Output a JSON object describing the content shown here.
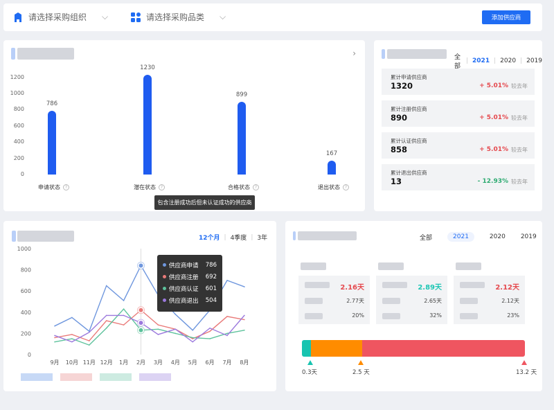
{
  "toolbar": {
    "org_placeholder": "请选择采购组织",
    "cat_placeholder": "请选择采购品类",
    "add_label": "添加供应商"
  },
  "status_chart": {
    "chart_data": {
      "type": "bar",
      "categories": [
        "申请状态",
        "潜在状态",
        "合格状态",
        "退出状态"
      ],
      "values": [
        786,
        1230,
        899,
        167
      ],
      "yticks": [
        1200,
        1000,
        800,
        600,
        400,
        200,
        0
      ],
      "ylim": [
        0,
        1230
      ],
      "grid": false
    },
    "tooltip": "包含注册成功后但未认证成功的供应商"
  },
  "supplier_stats": {
    "tabs": [
      "全部",
      "2021",
      "2020",
      "2019"
    ],
    "active_tab": "2021",
    "items": [
      {
        "label": "累计申请供应商",
        "value": "1320",
        "delta": "+ 5.01%",
        "suffix": "较去年",
        "dir": "up"
      },
      {
        "label": "累计注册供应商",
        "value": "890",
        "delta": "+ 5.01%",
        "suffix": "较去年",
        "dir": "up"
      },
      {
        "label": "累计认证供应商",
        "value": "858",
        "delta": "+ 5.01%",
        "suffix": "较去年",
        "dir": "up"
      },
      {
        "label": "累计退出供应商",
        "value": "13",
        "delta": "- 12.93%",
        "suffix": "较去年",
        "dir": "down"
      }
    ]
  },
  "trend_chart": {
    "tabs": [
      "12个月",
      "4季度",
      "3年"
    ],
    "active_tab": "12个月",
    "chart_data": {
      "type": "line",
      "categories": [
        "9月",
        "10月",
        "11月",
        "12月",
        "1月",
        "2月",
        "3月",
        "4月",
        "5月",
        "6月",
        "7月",
        "8月"
      ],
      "ylim": [
        0,
        1000
      ],
      "yticks": [
        1000,
        800,
        600,
        400,
        200,
        0
      ],
      "series": [
        {
          "name": "供应商申请",
          "color": "#6f97de",
          "values": [
            270,
            350,
            220,
            650,
            510,
            840,
            560,
            380,
            230,
            420,
            700,
            640
          ]
        },
        {
          "name": "供应商注册",
          "color": "#e97a79",
          "values": [
            160,
            190,
            130,
            320,
            280,
            420,
            280,
            240,
            150,
            220,
            360,
            330
          ]
        },
        {
          "name": "供应商认证",
          "color": "#5dc29c",
          "values": [
            120,
            150,
            90,
            250,
            430,
            230,
            240,
            200,
            160,
            150,
            200,
            230
          ]
        },
        {
          "name": "供应商退出",
          "color": "#9b78dd",
          "values": [
            180,
            120,
            210,
            370,
            370,
            300,
            190,
            240,
            120,
            250,
            180,
            370
          ]
        }
      ]
    },
    "tooltip": {
      "month_index": 5,
      "rows": [
        {
          "name": "供应商申请",
          "value": "786"
        },
        {
          "name": "供应商注册",
          "value": "692"
        },
        {
          "name": "供应商认证",
          "value": "601"
        },
        {
          "name": "供应商退出",
          "value": "504"
        }
      ]
    }
  },
  "cycle": {
    "tabs": [
      "全部",
      "2021",
      "2020",
      "2019"
    ],
    "active_tab": "2021",
    "boxes": [
      {
        "main": "2.16天",
        "main_color": "#e5484d",
        "r1": "2.77天",
        "r2": "20%"
      },
      {
        "main": "2.89天",
        "main_color": "#1ec6b4",
        "r1": "2.65天",
        "r2": "32%"
      },
      {
        "main": "2.12天",
        "main_color": "#e5484d",
        "r1": "2.12天",
        "r2": "23%"
      }
    ],
    "markers": [
      "0.3天",
      "2.5 天",
      "13.2 天"
    ],
    "segments": [
      {
        "value": 0.3,
        "color": "#18c4b0"
      },
      {
        "value": 2.5,
        "color": "#ff8c00"
      },
      {
        "value": 13.2,
        "color": "#ef5560"
      }
    ]
  }
}
